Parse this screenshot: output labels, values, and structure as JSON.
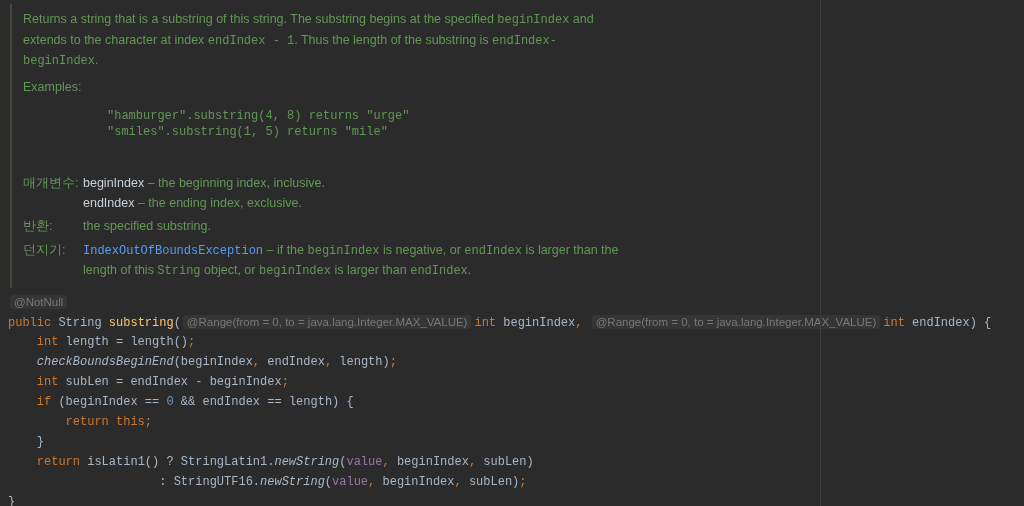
{
  "doc": {
    "description": [
      {
        "kind": "text",
        "text": "Returns a string that is a substring of this string. The substring begins at the specified "
      },
      {
        "kind": "code",
        "text": "beginIndex"
      },
      {
        "kind": "text",
        "text": " and extends to the character at index "
      },
      {
        "kind": "code",
        "text": "endIndex - 1"
      },
      {
        "kind": "text",
        "text": ". Thus the length of the substring is "
      },
      {
        "kind": "code",
        "text": "endIndex-beginIndex"
      },
      {
        "kind": "text",
        "text": "."
      }
    ],
    "examples_label": "Examples:",
    "examples": [
      "\"hamburger\".substring(4, 8) returns \"urge\"",
      "\"smiles\".substring(1, 5) returns \"mile\""
    ],
    "tags": [
      {
        "label": "매개변수:",
        "items": [
          [
            {
              "kind": "param",
              "text": "beginIndex"
            },
            {
              "kind": "text",
              "text": " – the beginning index, inclusive."
            }
          ],
          [
            {
              "kind": "param",
              "text": "endIndex"
            },
            {
              "kind": "text",
              "text": " – the ending index, exclusive."
            }
          ]
        ]
      },
      {
        "label": "반환:",
        "items": [
          [
            {
              "kind": "text",
              "text": "the specified substring."
            }
          ]
        ]
      },
      {
        "label": "던지기:",
        "items": [
          [
            {
              "kind": "link",
              "text": "IndexOutOfBoundsException"
            },
            {
              "kind": "text",
              "text": " – if the "
            },
            {
              "kind": "code",
              "text": "beginIndex"
            },
            {
              "kind": "text",
              "text": " is negative, or "
            },
            {
              "kind": "code",
              "text": "endIndex"
            },
            {
              "kind": "text",
              "text": " is larger than the length of this "
            },
            {
              "kind": "code",
              "text": "String"
            },
            {
              "kind": "text",
              "text": " object, or "
            },
            {
              "kind": "code",
              "text": "beginIndex"
            },
            {
              "kind": "text",
              "text": " is larger than "
            },
            {
              "kind": "code",
              "text": "endIndex"
            },
            {
              "kind": "text",
              "text": "."
            }
          ]
        ]
      }
    ]
  },
  "code": [
    [
      {
        "kind": "inlay",
        "text": "@NotNull"
      }
    ],
    [
      {
        "kind": "keyword",
        "text": "public "
      },
      {
        "kind": "plain",
        "text": "String "
      },
      {
        "kind": "declaration",
        "text": "substring"
      },
      {
        "kind": "plain",
        "text": "("
      },
      {
        "kind": "inlay",
        "text": "@Range(from = 0, to = java.lang.Integer.MAX_VALUE)"
      },
      {
        "kind": "keyword",
        "text": "int "
      },
      {
        "kind": "plain",
        "text": "beginIndex"
      },
      {
        "kind": "keyword",
        "text": ", "
      },
      {
        "kind": "inlay",
        "text": "@Range(from = 0, to = java.lang.Integer.MAX_VALUE)"
      },
      {
        "kind": "keyword",
        "text": "int "
      },
      {
        "kind": "plain",
        "text": "endIndex) {"
      }
    ],
    [
      {
        "kind": "keyword",
        "text": "    int "
      },
      {
        "kind": "plain",
        "text": "length = length()"
      },
      {
        "kind": "keyword",
        "text": ";"
      }
    ],
    [
      {
        "kind": "static",
        "text": "    checkBoundsBeginEnd"
      },
      {
        "kind": "plain",
        "text": "(beginIndex"
      },
      {
        "kind": "keyword",
        "text": ", "
      },
      {
        "kind": "plain",
        "text": "endIndex"
      },
      {
        "kind": "keyword",
        "text": ", "
      },
      {
        "kind": "plain",
        "text": "length)"
      },
      {
        "kind": "keyword",
        "text": ";"
      }
    ],
    [
      {
        "kind": "keyword",
        "text": "    int "
      },
      {
        "kind": "plain",
        "text": "subLen = endIndex - beginIndex"
      },
      {
        "kind": "keyword",
        "text": ";"
      }
    ],
    [
      {
        "kind": "keyword",
        "text": "    if "
      },
      {
        "kind": "plain",
        "text": "(beginIndex == "
      },
      {
        "kind": "number",
        "text": "0"
      },
      {
        "kind": "plain",
        "text": " && endIndex == length) {"
      }
    ],
    [
      {
        "kind": "keyword",
        "text": "        return this;"
      }
    ],
    [
      {
        "kind": "plain",
        "text": "    }"
      }
    ],
    [
      {
        "kind": "keyword",
        "text": "    return "
      },
      {
        "kind": "plain",
        "text": "isLatin1() ? StringLatin1."
      },
      {
        "kind": "static",
        "text": "newString"
      },
      {
        "kind": "plain",
        "text": "("
      },
      {
        "kind": "field",
        "text": "value"
      },
      {
        "kind": "keyword",
        "text": ", "
      },
      {
        "kind": "plain",
        "text": "beginIndex"
      },
      {
        "kind": "keyword",
        "text": ", "
      },
      {
        "kind": "plain",
        "text": "subLen)"
      }
    ],
    [
      {
        "kind": "plain",
        "text": "                     : StringUTF16."
      },
      {
        "kind": "static",
        "text": "newString"
      },
      {
        "kind": "plain",
        "text": "("
      },
      {
        "kind": "field",
        "text": "value"
      },
      {
        "kind": "keyword",
        "text": ", "
      },
      {
        "kind": "plain",
        "text": "beginIndex"
      },
      {
        "kind": "keyword",
        "text": ", "
      },
      {
        "kind": "plain",
        "text": "subLen)"
      },
      {
        "kind": "keyword",
        "text": ";"
      }
    ],
    [
      {
        "kind": "plain",
        "text": "}"
      }
    ]
  ]
}
